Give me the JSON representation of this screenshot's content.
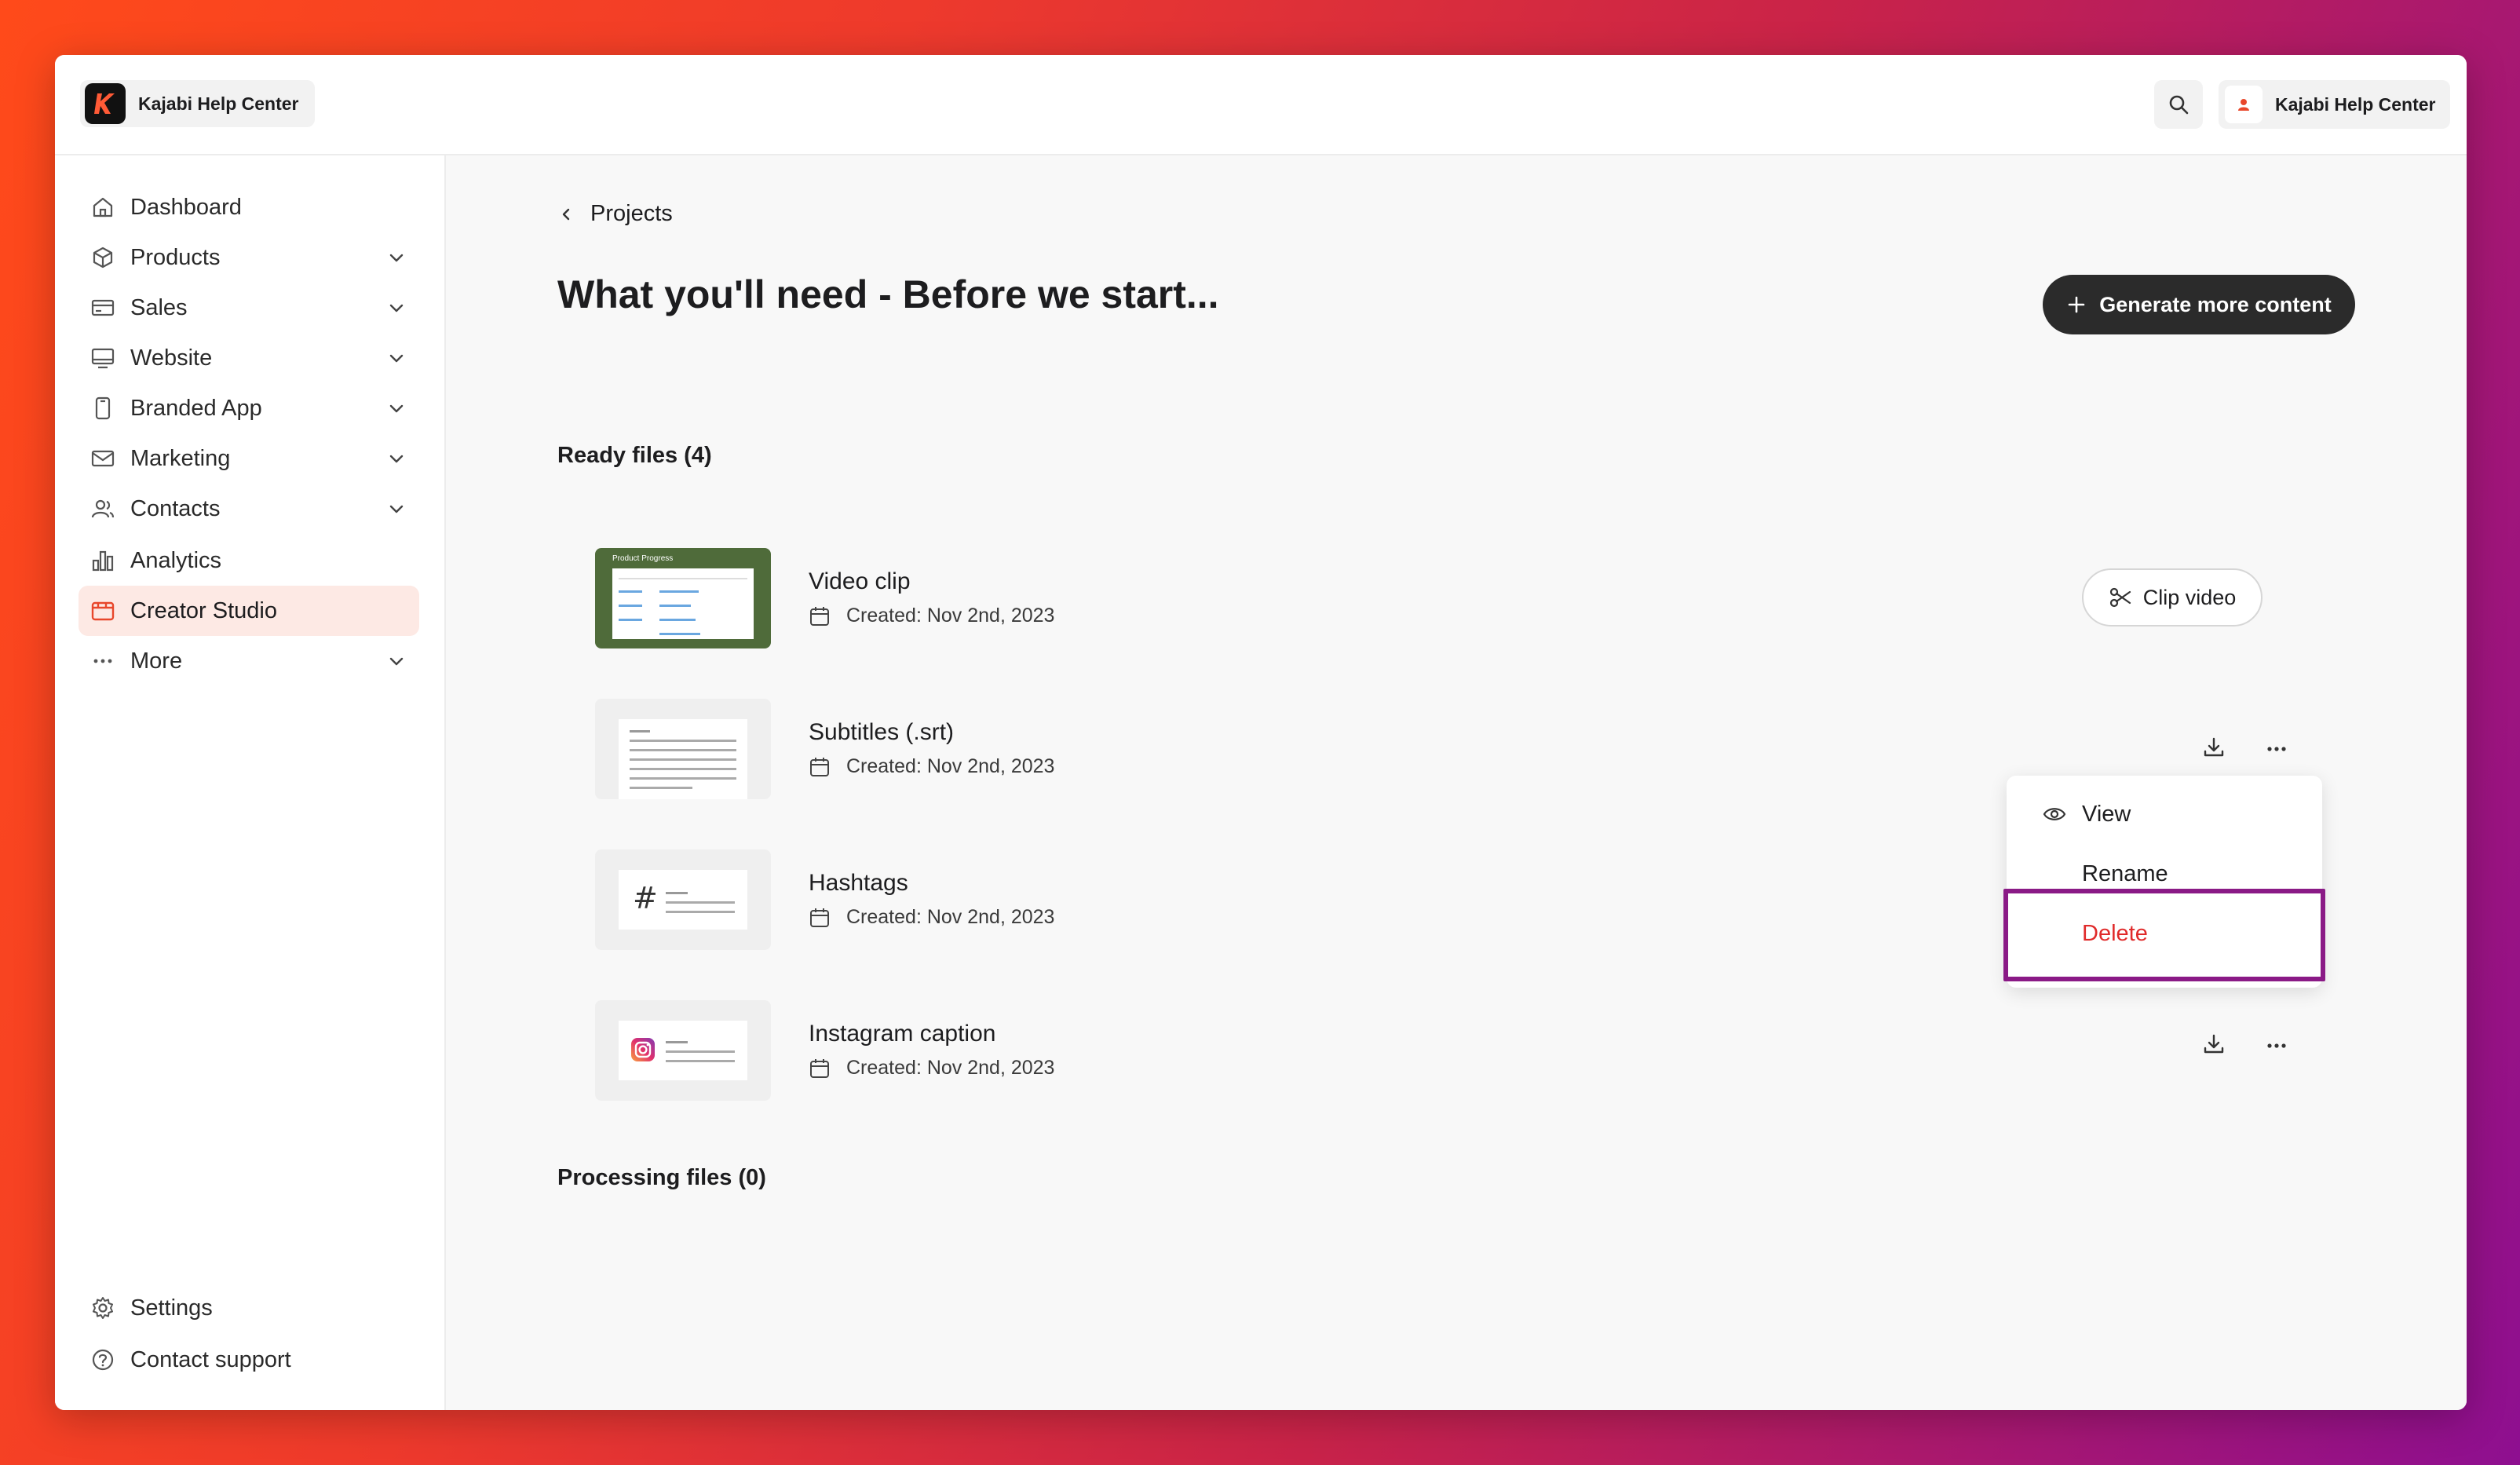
{
  "app": {
    "brand_name": "Kajabi Help Center",
    "account_name": "Kajabi Help Center"
  },
  "sidebar": {
    "items": [
      {
        "label": "Dashboard",
        "icon": "home-icon",
        "expandable": false,
        "active": false
      },
      {
        "label": "Products",
        "icon": "box-icon",
        "expandable": true,
        "active": false
      },
      {
        "label": "Sales",
        "icon": "card-icon",
        "expandable": true,
        "active": false
      },
      {
        "label": "Website",
        "icon": "monitor-icon",
        "expandable": true,
        "active": false
      },
      {
        "label": "Branded App",
        "icon": "phone-icon",
        "expandable": true,
        "active": false
      },
      {
        "label": "Marketing",
        "icon": "mail-icon",
        "expandable": true,
        "active": false
      },
      {
        "label": "Contacts",
        "icon": "contacts-icon",
        "expandable": true,
        "active": false
      },
      {
        "label": "Analytics",
        "icon": "analytics-icon",
        "expandable": false,
        "active": false
      },
      {
        "label": "Creator Studio",
        "icon": "creator-studio-icon",
        "expandable": false,
        "active": true
      },
      {
        "label": "More",
        "icon": "more-icon",
        "expandable": true,
        "active": false
      }
    ],
    "bottom_items": [
      {
        "label": "Settings",
        "icon": "gear-icon"
      },
      {
        "label": "Contact support",
        "icon": "help-icon"
      }
    ]
  },
  "main": {
    "back_label": "Projects",
    "title": "What you'll need - Before we start...",
    "generate_button": "Generate more content",
    "ready_section": "Ready files (4)",
    "processing_section": "Processing files (0)",
    "files": [
      {
        "name": "Video clip",
        "created": "Created: Nov 2nd, 2023",
        "thumb_title": "Product Progress"
      },
      {
        "name": "Subtitles (.srt)",
        "created": "Created: Nov 2nd, 2023"
      },
      {
        "name": "Hashtags",
        "created": "Created: Nov 2nd, 2023",
        "thumb_symbol": "#"
      },
      {
        "name": "Instagram caption",
        "created": "Created: Nov 2nd, 2023"
      }
    ],
    "clip_button": "Clip video"
  },
  "context_menu": {
    "view": "View",
    "rename": "Rename",
    "delete": "Delete"
  },
  "colors": {
    "accent": "#e8472b",
    "active_bg": "#fde9e4",
    "danger": "#e02a2a",
    "highlight": "#8a1a86",
    "primary_button": "#2b2b2b"
  }
}
